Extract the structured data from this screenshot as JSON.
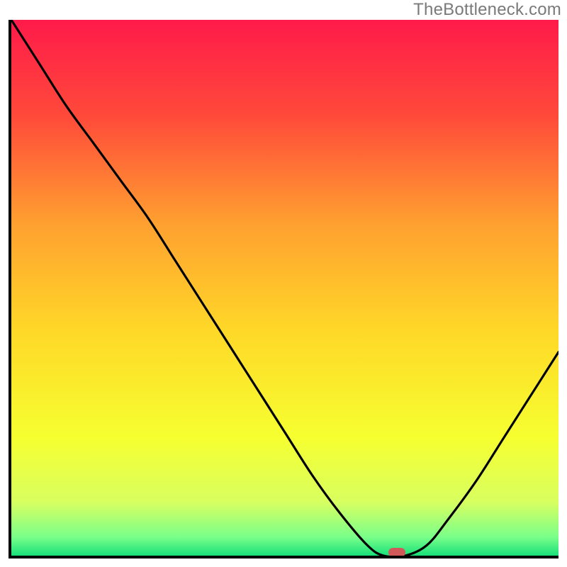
{
  "watermark": {
    "text": "TheBottleneck.com"
  },
  "chart_data": {
    "type": "line",
    "title": "",
    "xlabel": "",
    "ylabel": "",
    "x": [
      0.0,
      0.05,
      0.1,
      0.15,
      0.2,
      0.25,
      0.3,
      0.35,
      0.4,
      0.45,
      0.5,
      0.55,
      0.6,
      0.65,
      0.68,
      0.72,
      0.76,
      0.8,
      0.85,
      0.9,
      0.95,
      1.0
    ],
    "y": [
      1.0,
      0.92,
      0.84,
      0.77,
      0.7,
      0.63,
      0.55,
      0.47,
      0.39,
      0.31,
      0.23,
      0.15,
      0.08,
      0.02,
      0.0,
      0.0,
      0.02,
      0.07,
      0.14,
      0.22,
      0.3,
      0.38
    ],
    "xlim": [
      0,
      1
    ],
    "ylim": [
      0,
      1
    ],
    "marker": {
      "x": 0.705,
      "y": 0.0,
      "color": "#d05a5a"
    },
    "background_gradient": {
      "stops": [
        {
          "pos": 0.0,
          "color": "#ff1a4a"
        },
        {
          "pos": 0.18,
          "color": "#ff4a3a"
        },
        {
          "pos": 0.38,
          "color": "#ffa030"
        },
        {
          "pos": 0.58,
          "color": "#ffd828"
        },
        {
          "pos": 0.78,
          "color": "#f6ff30"
        },
        {
          "pos": 0.9,
          "color": "#d8ff60"
        },
        {
          "pos": 0.965,
          "color": "#7aff8a"
        },
        {
          "pos": 1.0,
          "color": "#18e07a"
        }
      ]
    }
  }
}
